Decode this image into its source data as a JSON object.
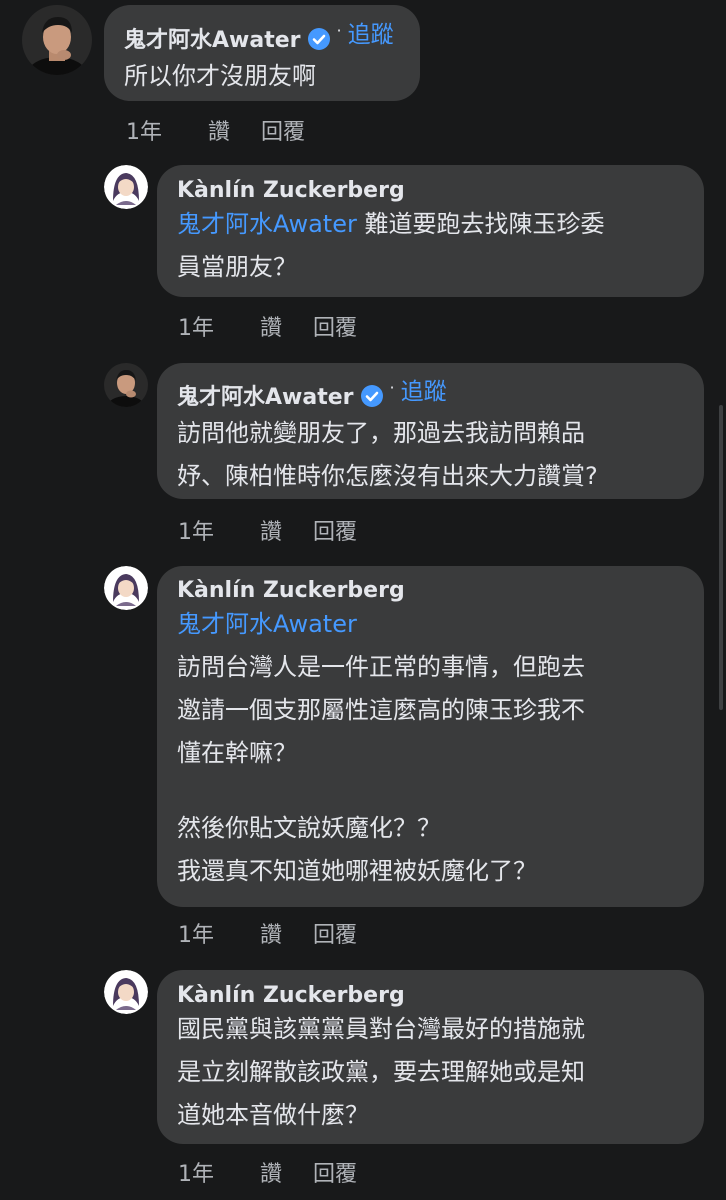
{
  "ui": {
    "follow_label": "追蹤",
    "separator": "·",
    "time_label": "1年",
    "like_label": "讚",
    "reply_label": "回覆"
  },
  "comments": [
    {
      "author": "鬼才阿水Awater",
      "verified": true,
      "lines": [
        "所以你才沒朋友啊"
      ]
    },
    {
      "author": "Kànlín Zuckerberg",
      "mention": "鬼才阿水Awater",
      "lines": [
        "難道要跑去找陳玉珍委",
        "員當朋友？"
      ]
    },
    {
      "author": "鬼才阿水Awater",
      "verified": true,
      "lines": [
        "訪問他就變朋友了，那過去我訪問賴品",
        "妤、陳柏惟時你怎麼沒有出來大力讚賞?"
      ]
    },
    {
      "author": "Kànlín Zuckerberg",
      "mention": "鬼才阿水Awater",
      "lines": [
        "訪問台灣人是一件正常的事情，但跑去",
        "邀請一個支那屬性這麼高的陳玉珍我不",
        "懂在幹嘛？",
        "",
        "然後你貼文說妖魔化？？",
        "我還真不知道她哪裡被妖魔化了？"
      ]
    },
    {
      "author": "Kànlín Zuckerberg",
      "lines": [
        "國民黨與該黨黨員對台灣最好的措施就",
        "是立刻解散該政黨，要去理解她或是知",
        "道她本音做什麼？"
      ]
    }
  ]
}
